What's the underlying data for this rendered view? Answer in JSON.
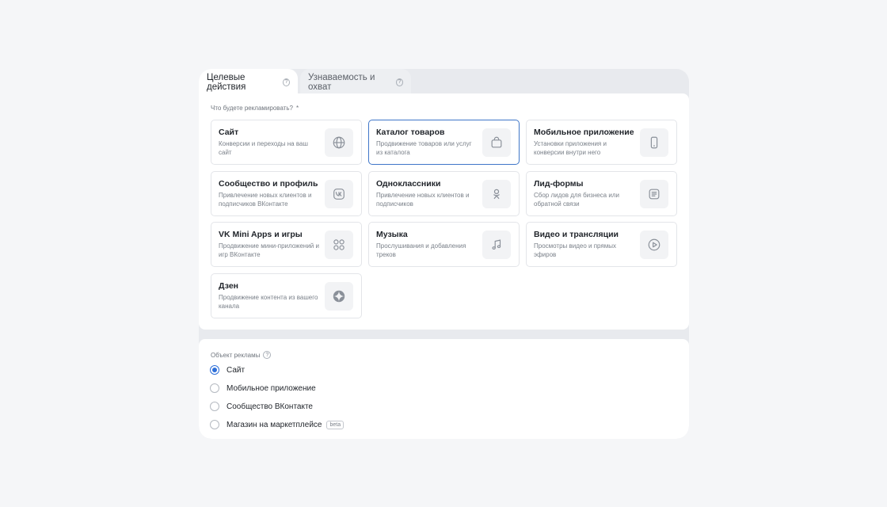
{
  "tabs": [
    {
      "label": "Целевые действия",
      "active": true
    },
    {
      "label": "Узнаваемость и охват",
      "active": false
    }
  ],
  "question": {
    "label": "Что будете рекламировать?",
    "required_mark": "*"
  },
  "cards": [
    {
      "title": "Сайт",
      "desc": "Конверсии и переходы на ваш сайт",
      "icon": "globe-icon",
      "selected": false
    },
    {
      "title": "Каталог товаров",
      "desc": "Продвижение товаров или услуг из каталога",
      "icon": "shopping-bag-icon",
      "selected": true
    },
    {
      "title": "Мобильное приложение",
      "desc": "Установки приложения и конверсии внутри него",
      "icon": "smartphone-icon",
      "selected": false
    },
    {
      "title": "Сообщество и профиль",
      "desc": "Привлечение новых клиентов и подписчиков ВКонтакте",
      "icon": "vk-logo-icon",
      "selected": false
    },
    {
      "title": "Одноклассники",
      "desc": "Привлечение новых клиентов и подписчиков",
      "icon": "ok-logo-icon",
      "selected": false
    },
    {
      "title": "Лид-формы",
      "desc": "Сбор лидов для бизнеса или обратной связи",
      "icon": "form-icon",
      "selected": false
    },
    {
      "title": "VK Mini Apps и игры",
      "desc": "Продвижение мини-приложений и игр ВКонтакте",
      "icon": "apps-grid-icon",
      "selected": false
    },
    {
      "title": "Музыка",
      "desc": "Прослушивания и добавления треков",
      "icon": "music-note-icon",
      "selected": false
    },
    {
      "title": "Видео и трансляции",
      "desc": "Просмотры видео и прямых эфиров",
      "icon": "play-icon",
      "selected": false
    },
    {
      "title": "Дзен",
      "desc": "Продвижение контента из вашего канала",
      "icon": "zen-logo-icon",
      "selected": false
    }
  ],
  "ad_object": {
    "label": "Объект рекламы",
    "options": [
      {
        "label": "Сайт",
        "checked": true
      },
      {
        "label": "Мобильное приложение",
        "checked": false
      },
      {
        "label": "Сообщество ВКонтакте",
        "checked": false
      },
      {
        "label": "Магазин на маркетплейсе",
        "checked": false,
        "badge": "beta"
      }
    ]
  },
  "colors": {
    "accent": "#2e6fd8",
    "selected_border": "#3f76c8"
  }
}
